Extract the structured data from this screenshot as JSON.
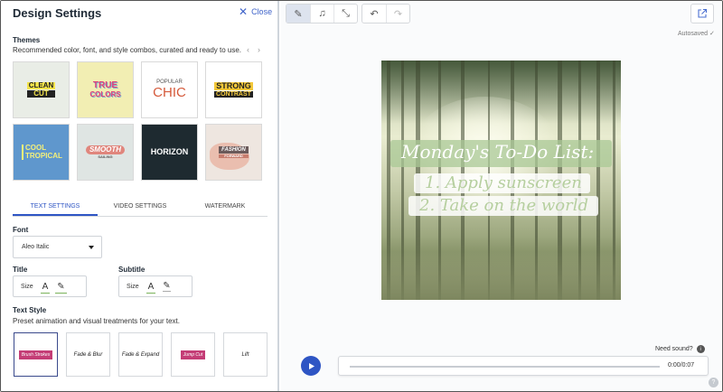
{
  "panel": {
    "title": "Design Settings",
    "close_label": "Close"
  },
  "themes": {
    "title": "Themes",
    "description": "Recommended color, font, and style combos, curated and ready to use.",
    "items": [
      {
        "line1": "CLEAN",
        "line2": "CUT"
      },
      {
        "line1": "TRUE",
        "line2": "COLORS"
      },
      {
        "line1": "POPULAR",
        "line2": "CHIC"
      },
      {
        "line1": "STRONG",
        "line2": "CONTRAST"
      },
      {
        "line1": "COOL",
        "line2": "TROPICAL"
      },
      {
        "line1": "SMOOTH",
        "line2": "SAILING"
      },
      {
        "line1": "HORIZON",
        "line2": ""
      },
      {
        "line1": "FASHION",
        "line2": "FORWARD"
      }
    ],
    "colors": [
      "#e9ede6",
      "#f2eeb3",
      "#ffffff",
      "#ffffff",
      "#5f97cd",
      "#dfe5e3",
      "#1e2a30",
      "#eee6e0"
    ]
  },
  "tabs": [
    "TEXT SETTINGS",
    "VIDEO SETTINGS",
    "WATERMARK"
  ],
  "font": {
    "label": "Font",
    "value": "Aleo Italic"
  },
  "title_ctrl": {
    "label": "Title",
    "size_label": "Size"
  },
  "subtitle_ctrl": {
    "label": "Subtitle",
    "size_label": "Size"
  },
  "text_style": {
    "title": "Text Style",
    "description": "Preset animation and visual treatments for your text.",
    "items": [
      "Brush Strokes",
      "Fade & Blur",
      "Fade & Expand",
      "Jump Cut",
      "Lift"
    ]
  },
  "workspace": {
    "autosaved": "Autosaved ✓",
    "preview": {
      "title": "Monday's To-Do List:",
      "line1": "1. Apply sunscreen",
      "line2": "2. Take on the world"
    },
    "need_sound": "Need sound?",
    "timecode": "0:00/0:07"
  },
  "accent_color": "#2e55c4"
}
